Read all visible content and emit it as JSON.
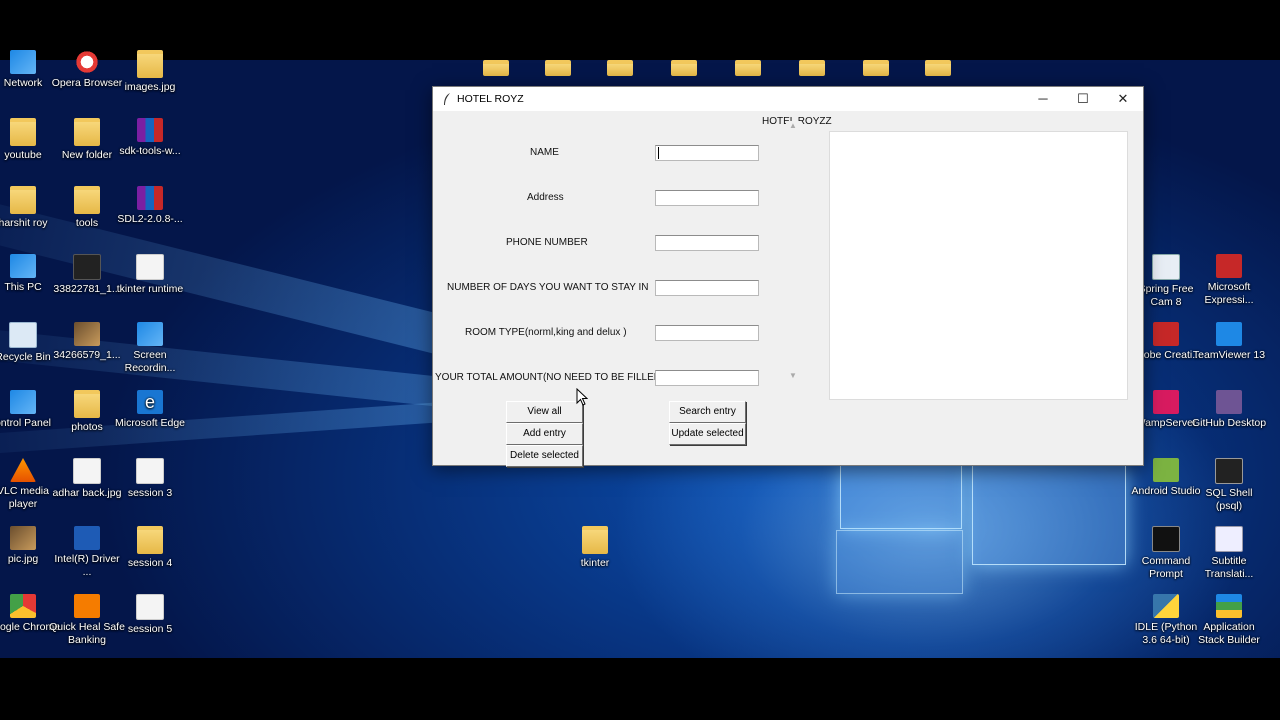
{
  "desktop_icons": [
    {
      "label": "Network",
      "glyph": "g-win"
    },
    {
      "label": "Opera Browser",
      "glyph": "g-opera"
    },
    {
      "label": "images.jpg",
      "glyph": "g-folder"
    },
    {
      "label": "youtube",
      "glyph": "g-folder"
    },
    {
      "label": "New folder",
      "glyph": "g-folder"
    },
    {
      "label": "sdk-tools-w...",
      "glyph": "g-rar"
    },
    {
      "label": "harshit roy",
      "glyph": "g-folder"
    },
    {
      "label": "tools",
      "glyph": "g-folder"
    },
    {
      "label": "SDL2-2.0.8-...",
      "glyph": "g-rar"
    },
    {
      "label": "This PC",
      "glyph": "g-win"
    },
    {
      "label": "33822781_1...",
      "glyph": "g-dark"
    },
    {
      "label": "tkinter runtime",
      "glyph": "g-file"
    },
    {
      "label": "Recycle Bin",
      "glyph": "g-bin"
    },
    {
      "label": "34266579_1...",
      "glyph": "g-img"
    },
    {
      "label": "Screen Recordin...",
      "glyph": "g-win"
    },
    {
      "label": "ontrol Panel",
      "glyph": "g-win"
    },
    {
      "label": "photos",
      "glyph": "g-folder"
    },
    {
      "label": "Microsoft Edge",
      "glyph": "g-edge"
    },
    {
      "label": "VLC media player",
      "glyph": "g-vlc"
    },
    {
      "label": "adhar back.jpg",
      "glyph": "g-file"
    },
    {
      "label": "session 3",
      "glyph": "g-file"
    },
    {
      "label": "pic.jpg",
      "glyph": "g-img"
    },
    {
      "label": "Intel(R) Driver ...",
      "glyph": "g-intel"
    },
    {
      "label": "session 4",
      "glyph": "g-folder"
    },
    {
      "label": "Google Chrome",
      "glyph": "g-chrome"
    },
    {
      "label": "Quick Heal Safe Banking",
      "glyph": "g-quick"
    },
    {
      "label": "session 5",
      "glyph": "g-file"
    },
    {
      "label": "tkinter",
      "glyph": "g-folder"
    },
    {
      "label": "Spring Free Cam 8",
      "glyph": "g-spring"
    },
    {
      "label": "Microsoft Expressi...",
      "glyph": "g-ms"
    },
    {
      "label": "Adobe Creati...",
      "glyph": "g-adobe"
    },
    {
      "label": "TeamViewer 13",
      "glyph": "g-tv"
    },
    {
      "label": "WampServer",
      "glyph": "g-wamp"
    },
    {
      "label": "GitHub Desktop",
      "glyph": "g-github"
    },
    {
      "label": "Android Studio",
      "glyph": "g-android"
    },
    {
      "label": "SQL Shell (psql)",
      "glyph": "g-sql"
    },
    {
      "label": "Command Prompt",
      "glyph": "g-cmd"
    },
    {
      "label": "Subtitle Translati...",
      "glyph": "g-sub"
    },
    {
      "label": "IDLE (Python 3.6 64-bit)",
      "glyph": "g-py"
    },
    {
      "label": "Application Stack Builder",
      "glyph": "g-stack"
    }
  ],
  "window": {
    "title": "HOTEL ROYZ",
    "icon": "feather-icon",
    "controls": {
      "minimize": "─",
      "maximize": "☐",
      "close": "✕"
    }
  },
  "form": {
    "heading": "HOTEL ROYZZ",
    "fields": [
      {
        "label": "NAME",
        "value": ""
      },
      {
        "label": "Address",
        "value": ""
      },
      {
        "label": "PHONE NUMBER",
        "value": ""
      },
      {
        "label": "NUMBER OF DAYS YOU WANT TO STAY IN",
        "value": ""
      },
      {
        "label": "ROOM TYPE(norml,king and delux )",
        "value": ""
      },
      {
        "label": "YOUR TOTAL AMOUNT(NO NEED TO BE FILLED)",
        "value": ""
      }
    ],
    "scroll": {
      "up": "▲",
      "down": "▼"
    }
  },
  "buttons": {
    "view_all": "View all",
    "add_entry": "Add entry",
    "delete_selected": "Delete selected",
    "search_entry": "Search entry",
    "update_selected": "Update selected"
  },
  "colors": {
    "window_bg": "#f0f0f0",
    "desktop_blue": "#0a3f96"
  }
}
